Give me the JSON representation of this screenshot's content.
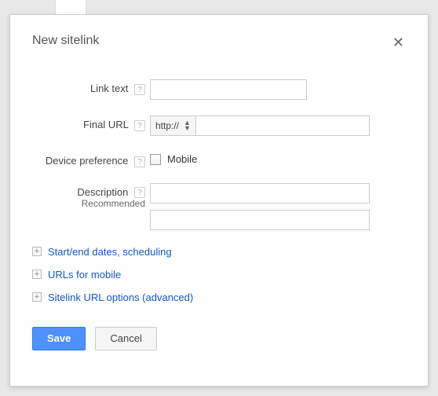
{
  "panel": {
    "title": "New sitelink"
  },
  "form": {
    "link_text_label": "Link text",
    "final_url_label": "Final URL",
    "final_url_protocol": "http://",
    "device_pref_label": "Device preference",
    "device_mobile_label": "Mobile",
    "description_label": "Description",
    "description_sub": "Recommended"
  },
  "expand": {
    "items": [
      {
        "label": "Start/end dates, scheduling"
      },
      {
        "label": "URLs for mobile"
      },
      {
        "label": "Sitelink URL options (advanced)"
      }
    ]
  },
  "buttons": {
    "save": "Save",
    "cancel": "Cancel"
  }
}
